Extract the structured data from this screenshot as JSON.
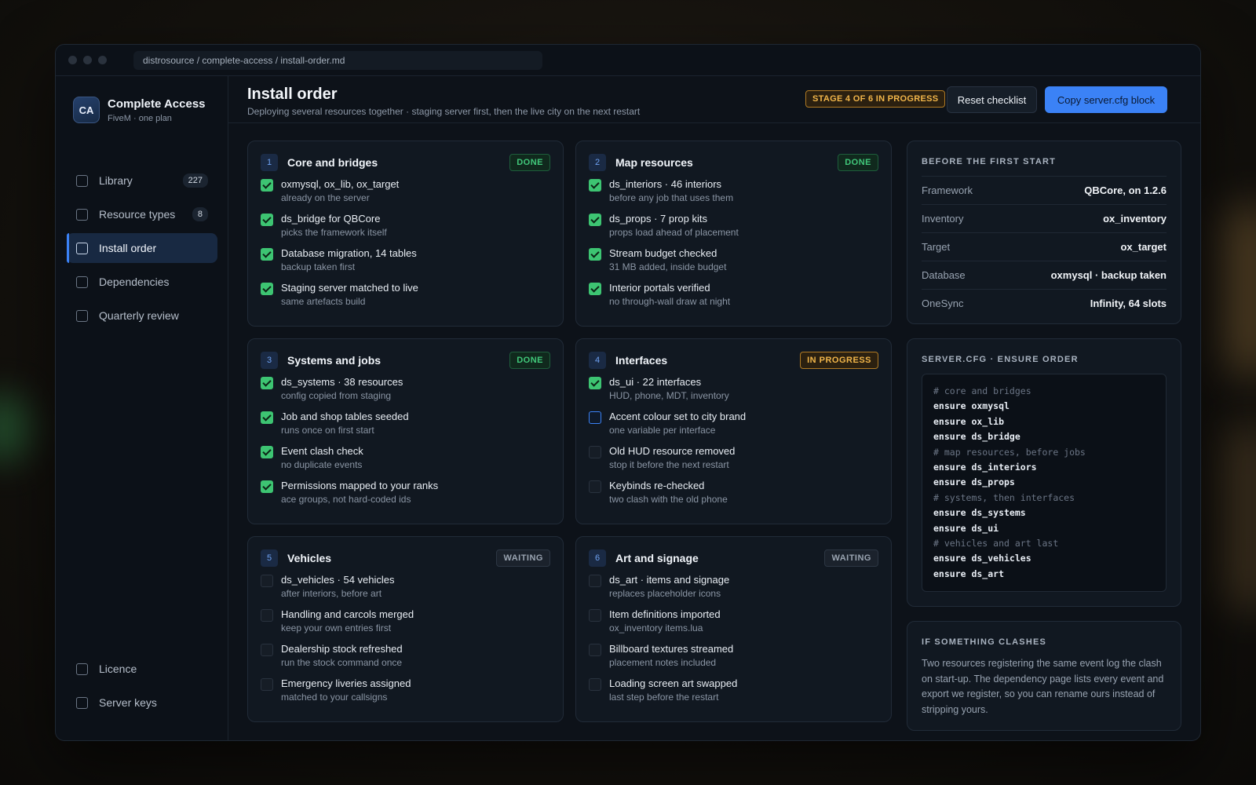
{
  "url": "distrosource / complete-access / install-order.md",
  "brand": {
    "logo": "CA",
    "name": "Complete Access",
    "subtitle": "FiveM · one plan"
  },
  "nav": {
    "items": [
      {
        "label": "Library",
        "count": "227",
        "active": false
      },
      {
        "label": "Resource types",
        "count": "8",
        "active": false
      },
      {
        "label": "Install order",
        "count": "",
        "active": true
      },
      {
        "label": "Dependencies",
        "count": "",
        "active": false
      },
      {
        "label": "Quarterly review",
        "count": "",
        "active": false
      }
    ],
    "bottom": [
      {
        "label": "Licence"
      },
      {
        "label": "Server keys"
      }
    ]
  },
  "header": {
    "title": "Install order",
    "subtitle": "Deploying several resources together · staging server first, then the live city on the next restart",
    "stage_badge": "STAGE 4 OF 6 IN PROGRESS",
    "reset_label": "Reset checklist",
    "copy_label": "Copy server.cfg block"
  },
  "stages": [
    {
      "num": "1",
      "title": "Core and bridges",
      "status": "DONE",
      "status_kind": "done",
      "tasks": [
        {
          "title": "oxmysql, ox_lib, ox_target",
          "desc": "already on the server",
          "state": "done"
        },
        {
          "title": "ds_bridge for QBCore",
          "desc": "picks the framework itself",
          "state": "done"
        },
        {
          "title": "Database migration, 14 tables",
          "desc": "backup taken first",
          "state": "done"
        },
        {
          "title": "Staging server matched to live",
          "desc": "same artefacts build",
          "state": "done"
        }
      ]
    },
    {
      "num": "2",
      "title": "Map resources",
      "status": "DONE",
      "status_kind": "done",
      "tasks": [
        {
          "title": "ds_interiors · 46 interiors",
          "desc": "before any job that uses them",
          "state": "done"
        },
        {
          "title": "ds_props · 7 prop kits",
          "desc": "props load ahead of placement",
          "state": "done"
        },
        {
          "title": "Stream budget checked",
          "desc": "31 MB added, inside budget",
          "state": "done"
        },
        {
          "title": "Interior portals verified",
          "desc": "no through-wall draw at night",
          "state": "done"
        }
      ]
    },
    {
      "num": "3",
      "title": "Systems and jobs",
      "status": "DONE",
      "status_kind": "done",
      "tasks": [
        {
          "title": "ds_systems · 38 resources",
          "desc": "config copied from staging",
          "state": "done"
        },
        {
          "title": "Job and shop tables seeded",
          "desc": "runs once on first start",
          "state": "done"
        },
        {
          "title": "Event clash check",
          "desc": "no duplicate events",
          "state": "done"
        },
        {
          "title": "Permissions mapped to your ranks",
          "desc": "ace groups, not hard-coded ids",
          "state": "done"
        }
      ]
    },
    {
      "num": "4",
      "title": "Interfaces",
      "status": "IN PROGRESS",
      "status_kind": "progress",
      "tasks": [
        {
          "title": "ds_ui · 22 interfaces",
          "desc": "HUD, phone, MDT, inventory",
          "state": "done"
        },
        {
          "title": "Accent colour set to city brand",
          "desc": "one variable per interface",
          "state": "active"
        },
        {
          "title": "Old HUD resource removed",
          "desc": "stop it before the next restart",
          "state": "todo"
        },
        {
          "title": "Keybinds re-checked",
          "desc": "two clash with the old phone",
          "state": "todo"
        }
      ]
    },
    {
      "num": "5",
      "title": "Vehicles",
      "status": "WAITING",
      "status_kind": "waiting",
      "tasks": [
        {
          "title": "ds_vehicles · 54 vehicles",
          "desc": "after interiors, before art",
          "state": "todo"
        },
        {
          "title": "Handling and carcols merged",
          "desc": "keep your own entries first",
          "state": "todo"
        },
        {
          "title": "Dealership stock refreshed",
          "desc": "run the stock command once",
          "state": "todo"
        },
        {
          "title": "Emergency liveries assigned",
          "desc": "matched to your callsigns",
          "state": "todo"
        }
      ]
    },
    {
      "num": "6",
      "title": "Art and signage",
      "status": "WAITING",
      "status_kind": "waiting",
      "tasks": [
        {
          "title": "ds_art · items and signage",
          "desc": "replaces placeholder icons",
          "state": "todo"
        },
        {
          "title": "Item definitions imported",
          "desc": "ox_inventory items.lua",
          "state": "todo"
        },
        {
          "title": "Billboard textures streamed",
          "desc": "placement notes included",
          "state": "todo"
        },
        {
          "title": "Loading screen art swapped",
          "desc": "last step before the restart",
          "state": "todo"
        }
      ]
    }
  ],
  "before_start": {
    "label": "BEFORE THE FIRST START",
    "rows": [
      {
        "key": "Framework",
        "value": "QBCore, on 1.2.6"
      },
      {
        "key": "Inventory",
        "value": "ox_inventory"
      },
      {
        "key": "Target",
        "value": "ox_target"
      },
      {
        "key": "Database",
        "value": "oxmysql · backup taken"
      },
      {
        "key": "OneSync",
        "value": "Infinity, 64 slots"
      }
    ]
  },
  "server_cfg": {
    "label": "SERVER.CFG · ENSURE ORDER",
    "lines": [
      {
        "text": "# core and bridges",
        "kind": "comment"
      },
      {
        "text": "ensure oxmysql",
        "kind": "cmd"
      },
      {
        "text": "ensure ox_lib",
        "kind": "cmd"
      },
      {
        "text": "ensure ds_bridge",
        "kind": "cmd"
      },
      {
        "text": "# map resources, before jobs",
        "kind": "comment"
      },
      {
        "text": "ensure ds_interiors",
        "kind": "cmd"
      },
      {
        "text": "ensure ds_props",
        "kind": "cmd"
      },
      {
        "text": "# systems, then interfaces",
        "kind": "comment"
      },
      {
        "text": "ensure ds_systems",
        "kind": "cmd"
      },
      {
        "text": "ensure ds_ui",
        "kind": "cmd"
      },
      {
        "text": "# vehicles and art last",
        "kind": "comment"
      },
      {
        "text": "ensure ds_vehicles",
        "kind": "cmd"
      },
      {
        "text": "ensure ds_art",
        "kind": "cmd"
      }
    ]
  },
  "clashes": {
    "label": "IF SOMETHING CLASHES",
    "text": "Two resources registering the same event log the clash on start-up. The dependency page lists every event and export we register, so you can rename ours instead of stripping yours."
  }
}
